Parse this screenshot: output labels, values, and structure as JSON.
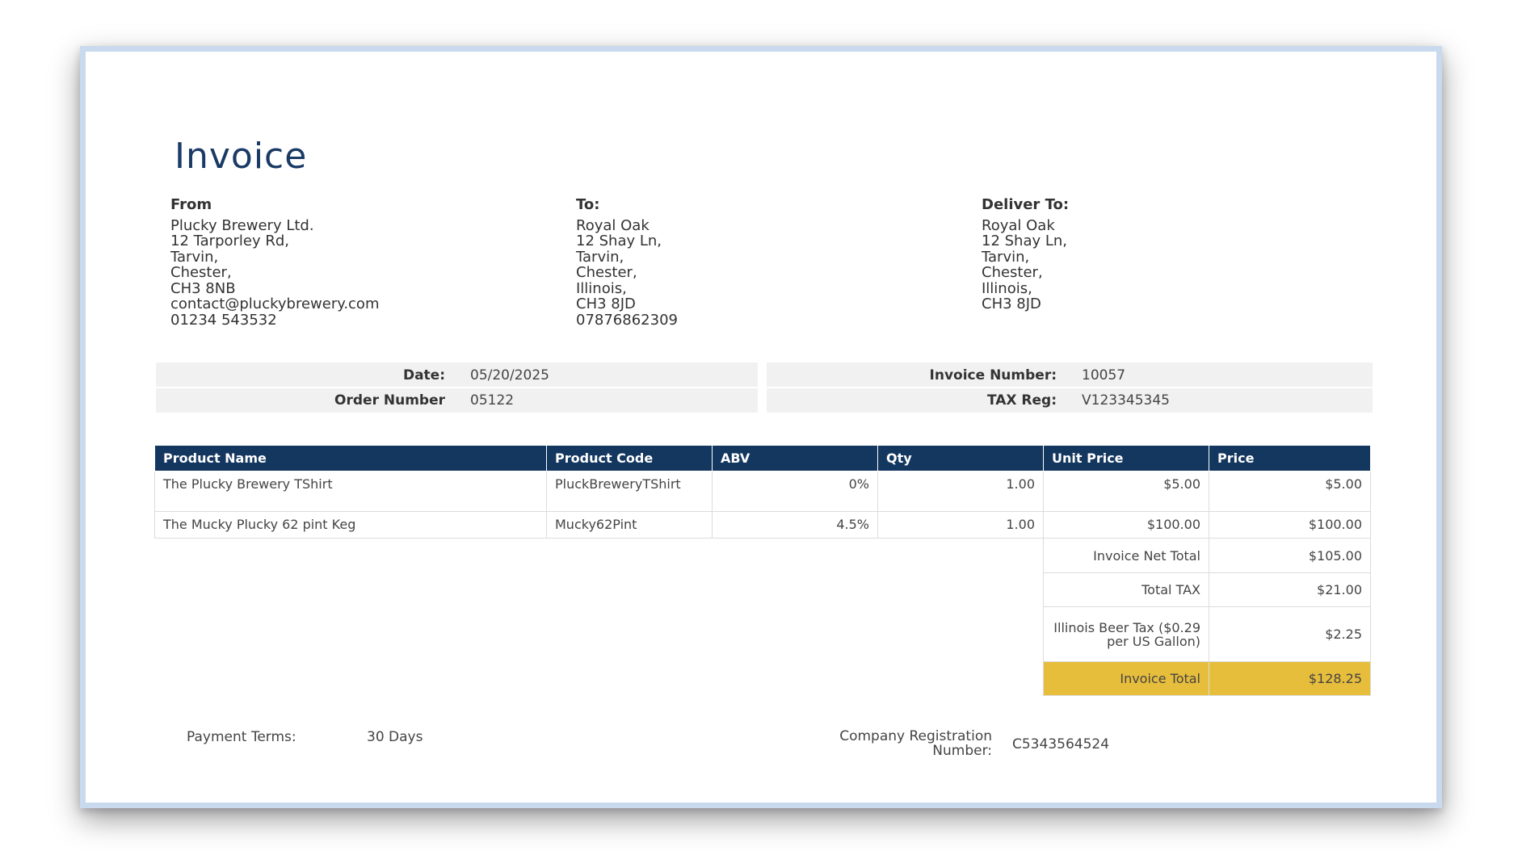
{
  "document": {
    "title": "Invoice"
  },
  "from": {
    "heading": "From",
    "lines": [
      "Plucky Brewery Ltd.",
      "12 Tarporley Rd,",
      "Tarvin,",
      "Chester,",
      "CH3 8NB",
      "contact@pluckybrewery.com",
      "01234 543532"
    ]
  },
  "to": {
    "heading": "To:",
    "lines": [
      "Royal Oak",
      "12 Shay Ln,",
      "Tarvin,",
      "Chester,",
      "Illinois,",
      "CH3 8JD",
      "07876862309"
    ]
  },
  "deliver_to": {
    "heading": "Deliver To:",
    "lines": [
      "Royal Oak",
      "12 Shay Ln,",
      "Tarvin,",
      "Chester,",
      "Illinois,",
      "CH3 8JD"
    ]
  },
  "meta": {
    "date_label": "Date:",
    "date_value": "05/20/2025",
    "order_label": "Order Number",
    "order_value": "05122",
    "invoice_number_label": "Invoice Number:",
    "invoice_number_value": "10057",
    "tax_reg_label": "TAX Reg:",
    "tax_reg_value": "V123345345"
  },
  "table": {
    "headers": [
      "Product Name",
      "Product Code",
      "ABV",
      "Qty",
      "Unit Price",
      "Price"
    ],
    "rows": [
      [
        "The Plucky Brewery TShirt",
        "PluckBreweryTShirt",
        "0%",
        "1.00",
        "$5.00",
        "$5.00"
      ],
      [
        "The Mucky Plucky 62 pint Keg",
        "Mucky62Pint",
        "4.5%",
        "1.00",
        "$100.00",
        "$100.00"
      ]
    ],
    "net_total_label": "Invoice Net Total",
    "net_total_value": "$105.00",
    "total_tax_label": "Total TAX",
    "total_tax_value": "$21.00",
    "beer_tax_label": "Illinois Beer Tax ($0.29 per US Gallon)",
    "beer_tax_value": "$2.25",
    "invoice_total_label": "Invoice Total",
    "invoice_total_value": "$128.25"
  },
  "footer": {
    "payment_terms_label": "Payment Terms:",
    "payment_terms_value": "30 Days",
    "company_reg_label": "Company Registration Number:",
    "company_reg_value": "C5343564524"
  },
  "colors": {
    "header_navy": "#14375f",
    "title_blue": "#1a3a66",
    "total_gold": "#e7bd3c",
    "meta_grey": "#f1f1f1"
  }
}
